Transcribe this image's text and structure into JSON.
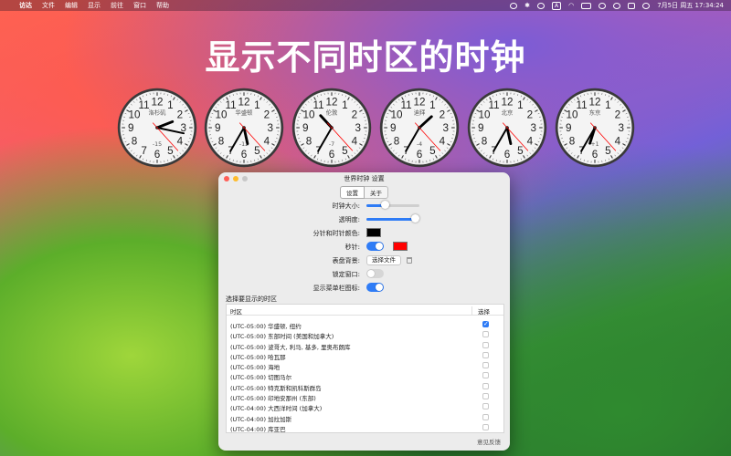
{
  "menubar": {
    "app": "访达",
    "menus": [
      "文件",
      "编辑",
      "显示",
      "前往",
      "窗口",
      "帮助"
    ],
    "input_indicator": "A",
    "datetime": "7月5日 周五  17:34:24"
  },
  "headline": "显示不同时区的时钟",
  "clocks": [
    {
      "city": "洛杉矶",
      "offset": "-15",
      "hour": 2,
      "minute": 17,
      "second": 23
    },
    {
      "city": "华盛顿",
      "offset": "-12",
      "hour": 5,
      "minute": 35,
      "second": 23
    },
    {
      "city": "伦敦",
      "offset": "-7",
      "hour": 10,
      "minute": 35,
      "second": 23
    },
    {
      "city": "迪拜",
      "offset": "-4",
      "hour": 1,
      "minute": 35,
      "second": 23
    },
    {
      "city": "北京",
      "offset": "",
      "hour": 5,
      "minute": 35,
      "second": 23
    },
    {
      "city": "东京",
      "offset": "+1",
      "hour": 6,
      "minute": 35,
      "second": 23
    }
  ],
  "window": {
    "title": "世界时钟 设置",
    "tabs": [
      "设置",
      "关于"
    ],
    "labels": {
      "clock_size": "时钟大小:",
      "opacity": "透明度:",
      "hand_color": "分针和时针颜色:",
      "second_hand": "秒针:",
      "dial_bg": "表盘背景:",
      "lock_window": "锁定窗口:",
      "menubar_icon": "显示菜单栏图标:"
    },
    "controls": {
      "clock_size": 0.35,
      "opacity": 0.92,
      "hand_color": "#000000",
      "second_color": "#ff0000",
      "second_hand_on": true,
      "lock_window_on": false,
      "menubar_icon_on": true
    },
    "choose_file": "选择文件",
    "tz_section": "选择要显示的时区",
    "table_headers": {
      "zone": "时区",
      "select": "选择"
    },
    "rows": [
      {
        "name": "(UTC-05:00) 华盛顿, 纽约",
        "checked": true
      },
      {
        "name": "(UTC-05:00) 东部时间 (美国和加拿大)",
        "checked": false
      },
      {
        "name": "(UTC-05:00) 波哥大, 利马, 基多, 里奥布朗库",
        "checked": false
      },
      {
        "name": "(UTC-05:00) 哈瓦那",
        "checked": false
      },
      {
        "name": "(UTC-05:00) 海地",
        "checked": false
      },
      {
        "name": "(UTC-05:00) 切图马尔",
        "checked": false
      },
      {
        "name": "(UTC-05:00) 特克斯和凯科斯群岛",
        "checked": false
      },
      {
        "name": "(UTC-05:00) 印地安那州 (东部)",
        "checked": false
      },
      {
        "name": "(UTC-04:00) 大西洋时间 (加拿大)",
        "checked": false
      },
      {
        "name": "(UTC-04:00) 加拉加斯",
        "checked": false
      },
      {
        "name": "(UTC-04:00) 库亚巴",
        "checked": false
      }
    ],
    "feedback": "意见反馈"
  }
}
